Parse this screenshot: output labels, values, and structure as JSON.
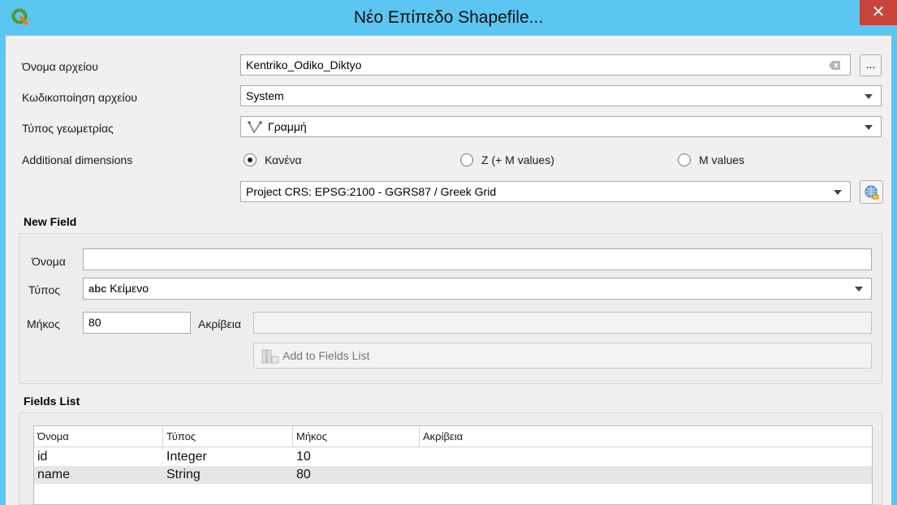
{
  "window": {
    "title": "Νέο Επίπεδο Shapefile...",
    "close_label": "✕"
  },
  "form": {
    "file_name": {
      "label": "Όνομα αρχείου",
      "value": "Kentriko_Odiko_Diktyo",
      "browse_label": "..."
    },
    "encoding": {
      "label": "Κωδικοποίηση αρχείου",
      "value": "System"
    },
    "geometry": {
      "label": "Τύπος γεωμετρίας",
      "value": "Γραμμή"
    },
    "dimensions": {
      "label": "Additional dimensions",
      "options": [
        "Κανένα",
        "Z (+ M values)",
        "M values"
      ],
      "selected": "Κανένα"
    },
    "crs": {
      "value": "Project CRS: EPSG:2100 - GGRS87 / Greek Grid"
    }
  },
  "new_field": {
    "title": "New Field",
    "name_label": "Όνομα",
    "name_value": "",
    "type_label": "Τύπος",
    "type_prefix": "abc",
    "type_value": "Κείμενο",
    "length_label": "Μήκος",
    "length_value": "80",
    "precision_label": "Ακρίβεια",
    "precision_value": "",
    "add_button": "Add to Fields List"
  },
  "fields_list": {
    "title": "Fields List",
    "columns": [
      "Όνομα",
      "Τύπος",
      "Μήκος",
      "Ακρίβεια"
    ],
    "rows": [
      [
        "id",
        "Integer",
        "10",
        ""
      ],
      [
        "name",
        "String",
        "80",
        ""
      ]
    ]
  }
}
